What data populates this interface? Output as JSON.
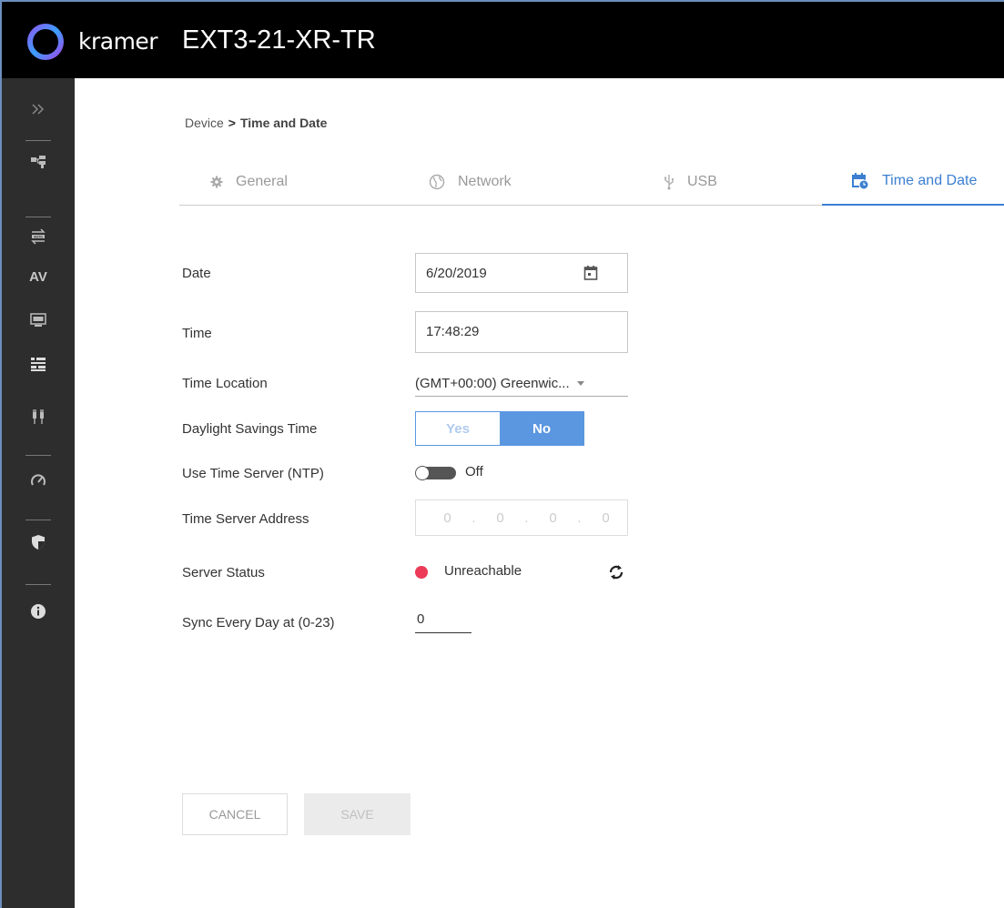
{
  "header": {
    "brand": "kramer",
    "device_name": "EXT3-21-XR-TR"
  },
  "sidebar": {
    "items": [
      {
        "icon": "double-chevron-right-icon"
      },
      {
        "icon": "topology-icon"
      },
      {
        "icon": "auto-switch-icon"
      },
      {
        "icon": "av-icon",
        "label": "AV"
      },
      {
        "icon": "edid-icon"
      },
      {
        "icon": "device-settings-icon",
        "active": true
      },
      {
        "icon": "cable-icon"
      },
      {
        "icon": "gauge-icon"
      },
      {
        "icon": "security-shield-icon"
      },
      {
        "icon": "info-icon"
      }
    ],
    "accent": "#3d8fe0"
  },
  "breadcrumb": {
    "parent": "Device",
    "separator": ">",
    "current": "Time and Date"
  },
  "tabs": [
    {
      "label": "General",
      "icon": "gear-icon"
    },
    {
      "label": "Network",
      "icon": "globe-icon"
    },
    {
      "label": "USB",
      "icon": "usb-icon"
    },
    {
      "label": "Time and Date",
      "icon": "calendar-clock-icon",
      "active": true
    }
  ],
  "form": {
    "date": {
      "label": "Date",
      "value": "6/20/2019"
    },
    "time": {
      "label": "Time",
      "value": "17:48:29"
    },
    "time_location": {
      "label": "Time Location",
      "value": "(GMT+00:00) Greenwic..."
    },
    "dst": {
      "label": "Daylight Savings Time",
      "yes": "Yes",
      "no": "No",
      "selected": "No"
    },
    "ntp": {
      "label": "Use Time Server (NTP)",
      "state": "Off"
    },
    "server_address": {
      "label": "Time Server Address",
      "octets": [
        "0",
        ".",
        "0",
        ".",
        "0",
        ".",
        "0"
      ]
    },
    "server_status": {
      "label": "Server Status",
      "value": "Unreachable",
      "color": "#ec3a58"
    },
    "sync": {
      "label": "Sync Every Day at (0-23)",
      "value": "0"
    }
  },
  "actions": {
    "cancel": "CANCEL",
    "save": "SAVE"
  }
}
